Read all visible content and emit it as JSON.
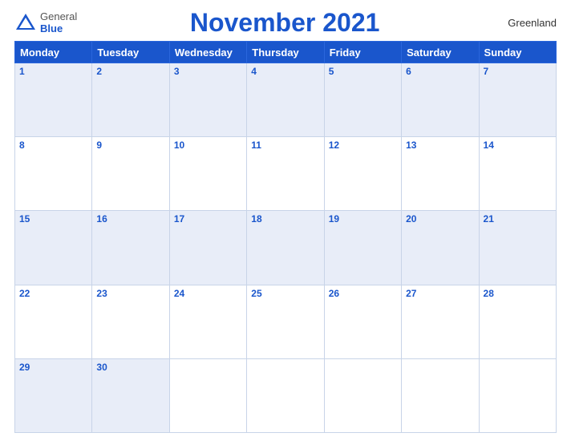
{
  "header": {
    "logo_general": "General",
    "logo_blue": "Blue",
    "title": "November 2021",
    "region": "Greenland"
  },
  "weekdays": [
    "Monday",
    "Tuesday",
    "Wednesday",
    "Thursday",
    "Friday",
    "Saturday",
    "Sunday"
  ],
  "weeks": [
    [
      {
        "day": "1",
        "empty": false
      },
      {
        "day": "2",
        "empty": false
      },
      {
        "day": "3",
        "empty": false
      },
      {
        "day": "4",
        "empty": false
      },
      {
        "day": "5",
        "empty": false
      },
      {
        "day": "6",
        "empty": false
      },
      {
        "day": "7",
        "empty": false
      }
    ],
    [
      {
        "day": "8",
        "empty": false
      },
      {
        "day": "9",
        "empty": false
      },
      {
        "day": "10",
        "empty": false
      },
      {
        "day": "11",
        "empty": false
      },
      {
        "day": "12",
        "empty": false
      },
      {
        "day": "13",
        "empty": false
      },
      {
        "day": "14",
        "empty": false
      }
    ],
    [
      {
        "day": "15",
        "empty": false
      },
      {
        "day": "16",
        "empty": false
      },
      {
        "day": "17",
        "empty": false
      },
      {
        "day": "18",
        "empty": false
      },
      {
        "day": "19",
        "empty": false
      },
      {
        "day": "20",
        "empty": false
      },
      {
        "day": "21",
        "empty": false
      }
    ],
    [
      {
        "day": "22",
        "empty": false
      },
      {
        "day": "23",
        "empty": false
      },
      {
        "day": "24",
        "empty": false
      },
      {
        "day": "25",
        "empty": false
      },
      {
        "day": "26",
        "empty": false
      },
      {
        "day": "27",
        "empty": false
      },
      {
        "day": "28",
        "empty": false
      }
    ],
    [
      {
        "day": "29",
        "empty": false
      },
      {
        "day": "30",
        "empty": false
      },
      {
        "day": "",
        "empty": true
      },
      {
        "day": "",
        "empty": true
      },
      {
        "day": "",
        "empty": true
      },
      {
        "day": "",
        "empty": true
      },
      {
        "day": "",
        "empty": true
      }
    ]
  ]
}
